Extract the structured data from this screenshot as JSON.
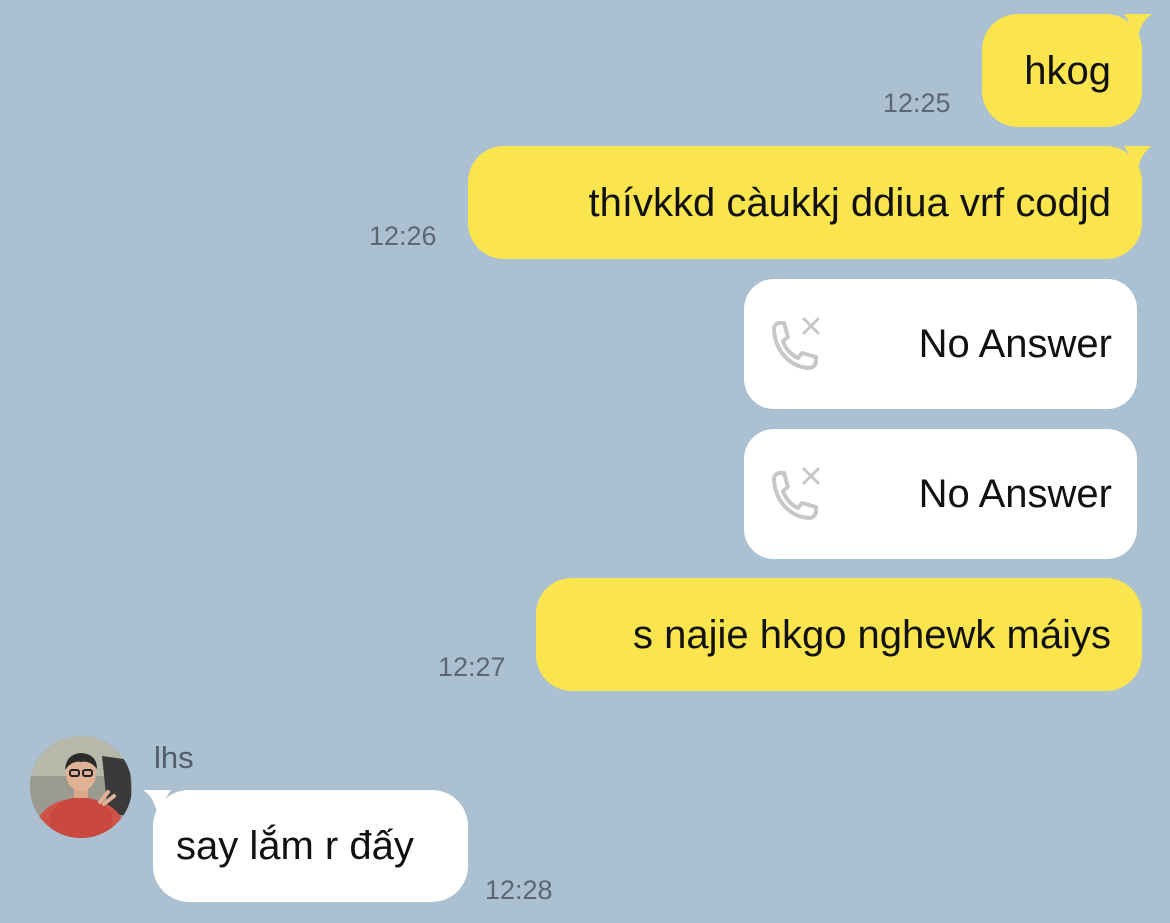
{
  "chat": {
    "outgoing": [
      {
        "text": "hkog",
        "time": "12:25"
      },
      {
        "text": "thívkkd càukkj ddiua vrf codjd",
        "time": "12:26"
      },
      {
        "text": "s najie hkgo nghewk máiys",
        "time": "12:27"
      }
    ],
    "calls": [
      {
        "label": "No Answer",
        "icon": "missed-call-icon"
      },
      {
        "label": "No Answer",
        "icon": "missed-call-icon"
      }
    ],
    "incoming": [
      {
        "sender": "lhs",
        "text": "say lắm r đấy",
        "time": "12:28",
        "avatar": "profile-photo"
      }
    ]
  },
  "colors": {
    "background": "#abc1d1",
    "outgoing_bubble": "#fae54e",
    "incoming_bubble": "#ffffff",
    "timestamp": "#5d6773"
  }
}
